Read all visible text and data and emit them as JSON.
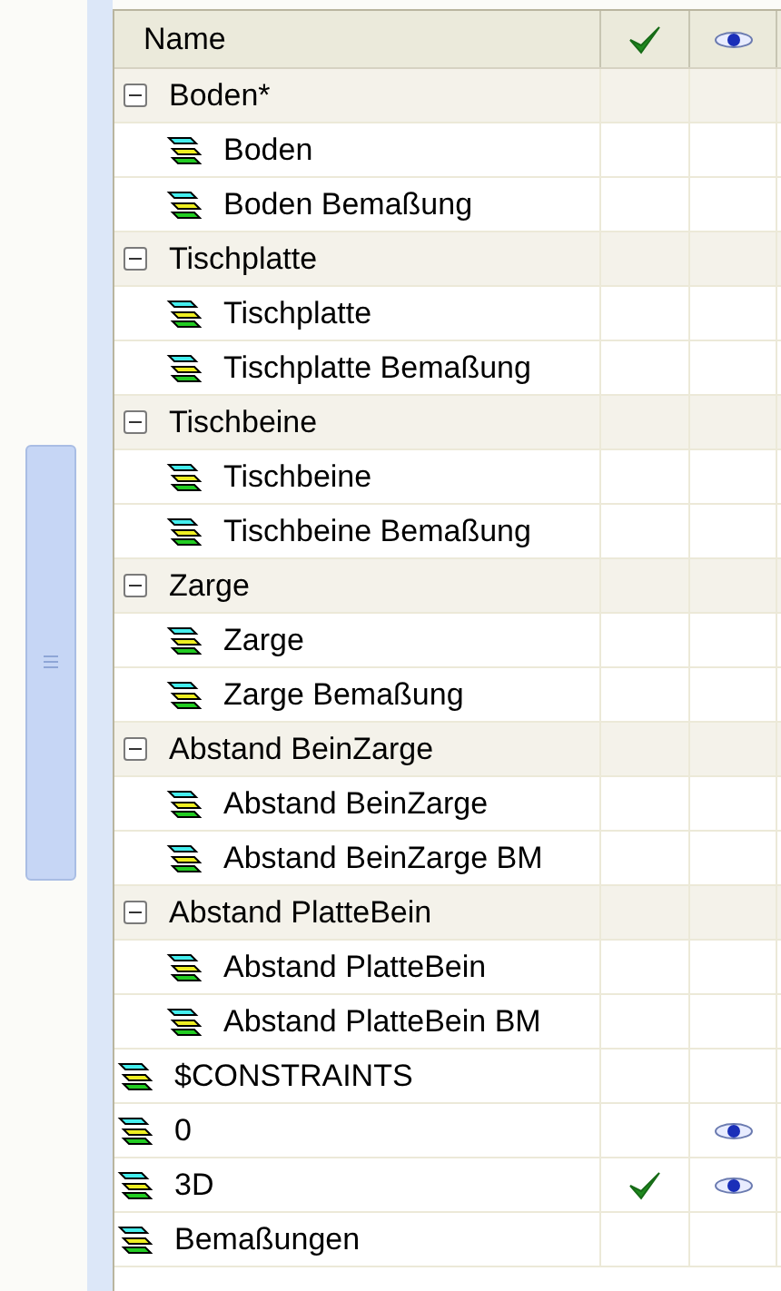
{
  "table": {
    "columns": [
      {
        "kind": "text",
        "label": "Name"
      },
      {
        "kind": "check"
      },
      {
        "kind": "eye"
      }
    ],
    "rows": [
      {
        "kind": "group",
        "name": "Boden*",
        "expanded": true,
        "children": [
          {
            "kind": "layer",
            "name": "Boden",
            "active": false,
            "visible": false
          },
          {
            "kind": "layer",
            "name": "Boden Bemaßung",
            "active": false,
            "visible": false
          }
        ]
      },
      {
        "kind": "group",
        "name": "Tischplatte",
        "expanded": true,
        "children": [
          {
            "kind": "layer",
            "name": "Tischplatte",
            "active": false,
            "visible": false
          },
          {
            "kind": "layer",
            "name": "Tischplatte Bemaßung",
            "active": false,
            "visible": false
          }
        ]
      },
      {
        "kind": "group",
        "name": "Tischbeine",
        "expanded": true,
        "children": [
          {
            "kind": "layer",
            "name": "Tischbeine",
            "active": false,
            "visible": false
          },
          {
            "kind": "layer",
            "name": "Tischbeine Bemaßung",
            "active": false,
            "visible": false
          }
        ]
      },
      {
        "kind": "group",
        "name": "Zarge",
        "expanded": true,
        "children": [
          {
            "kind": "layer",
            "name": "Zarge",
            "active": false,
            "visible": false
          },
          {
            "kind": "layer",
            "name": "Zarge Bemaßung",
            "active": false,
            "visible": false
          }
        ]
      },
      {
        "kind": "group",
        "name": "Abstand BeinZarge",
        "expanded": true,
        "children": [
          {
            "kind": "layer",
            "name": "Abstand BeinZarge",
            "active": false,
            "visible": false
          },
          {
            "kind": "layer",
            "name": "Abstand BeinZarge BM",
            "active": false,
            "visible": false
          }
        ]
      },
      {
        "kind": "group",
        "name": "Abstand PlatteBein",
        "expanded": true,
        "children": [
          {
            "kind": "layer",
            "name": "Abstand PlatteBein",
            "active": false,
            "visible": false
          },
          {
            "kind": "layer",
            "name": "Abstand PlatteBein BM",
            "active": false,
            "visible": false
          }
        ]
      },
      {
        "kind": "layer",
        "name": "$CONSTRAINTS",
        "active": false,
        "visible": false
      },
      {
        "kind": "layer",
        "name": "0",
        "active": false,
        "visible": true
      },
      {
        "kind": "layer",
        "name": "3D",
        "active": true,
        "visible": true
      },
      {
        "kind": "layer",
        "name": "Bemaßungen",
        "active": false,
        "visible": false
      }
    ]
  }
}
